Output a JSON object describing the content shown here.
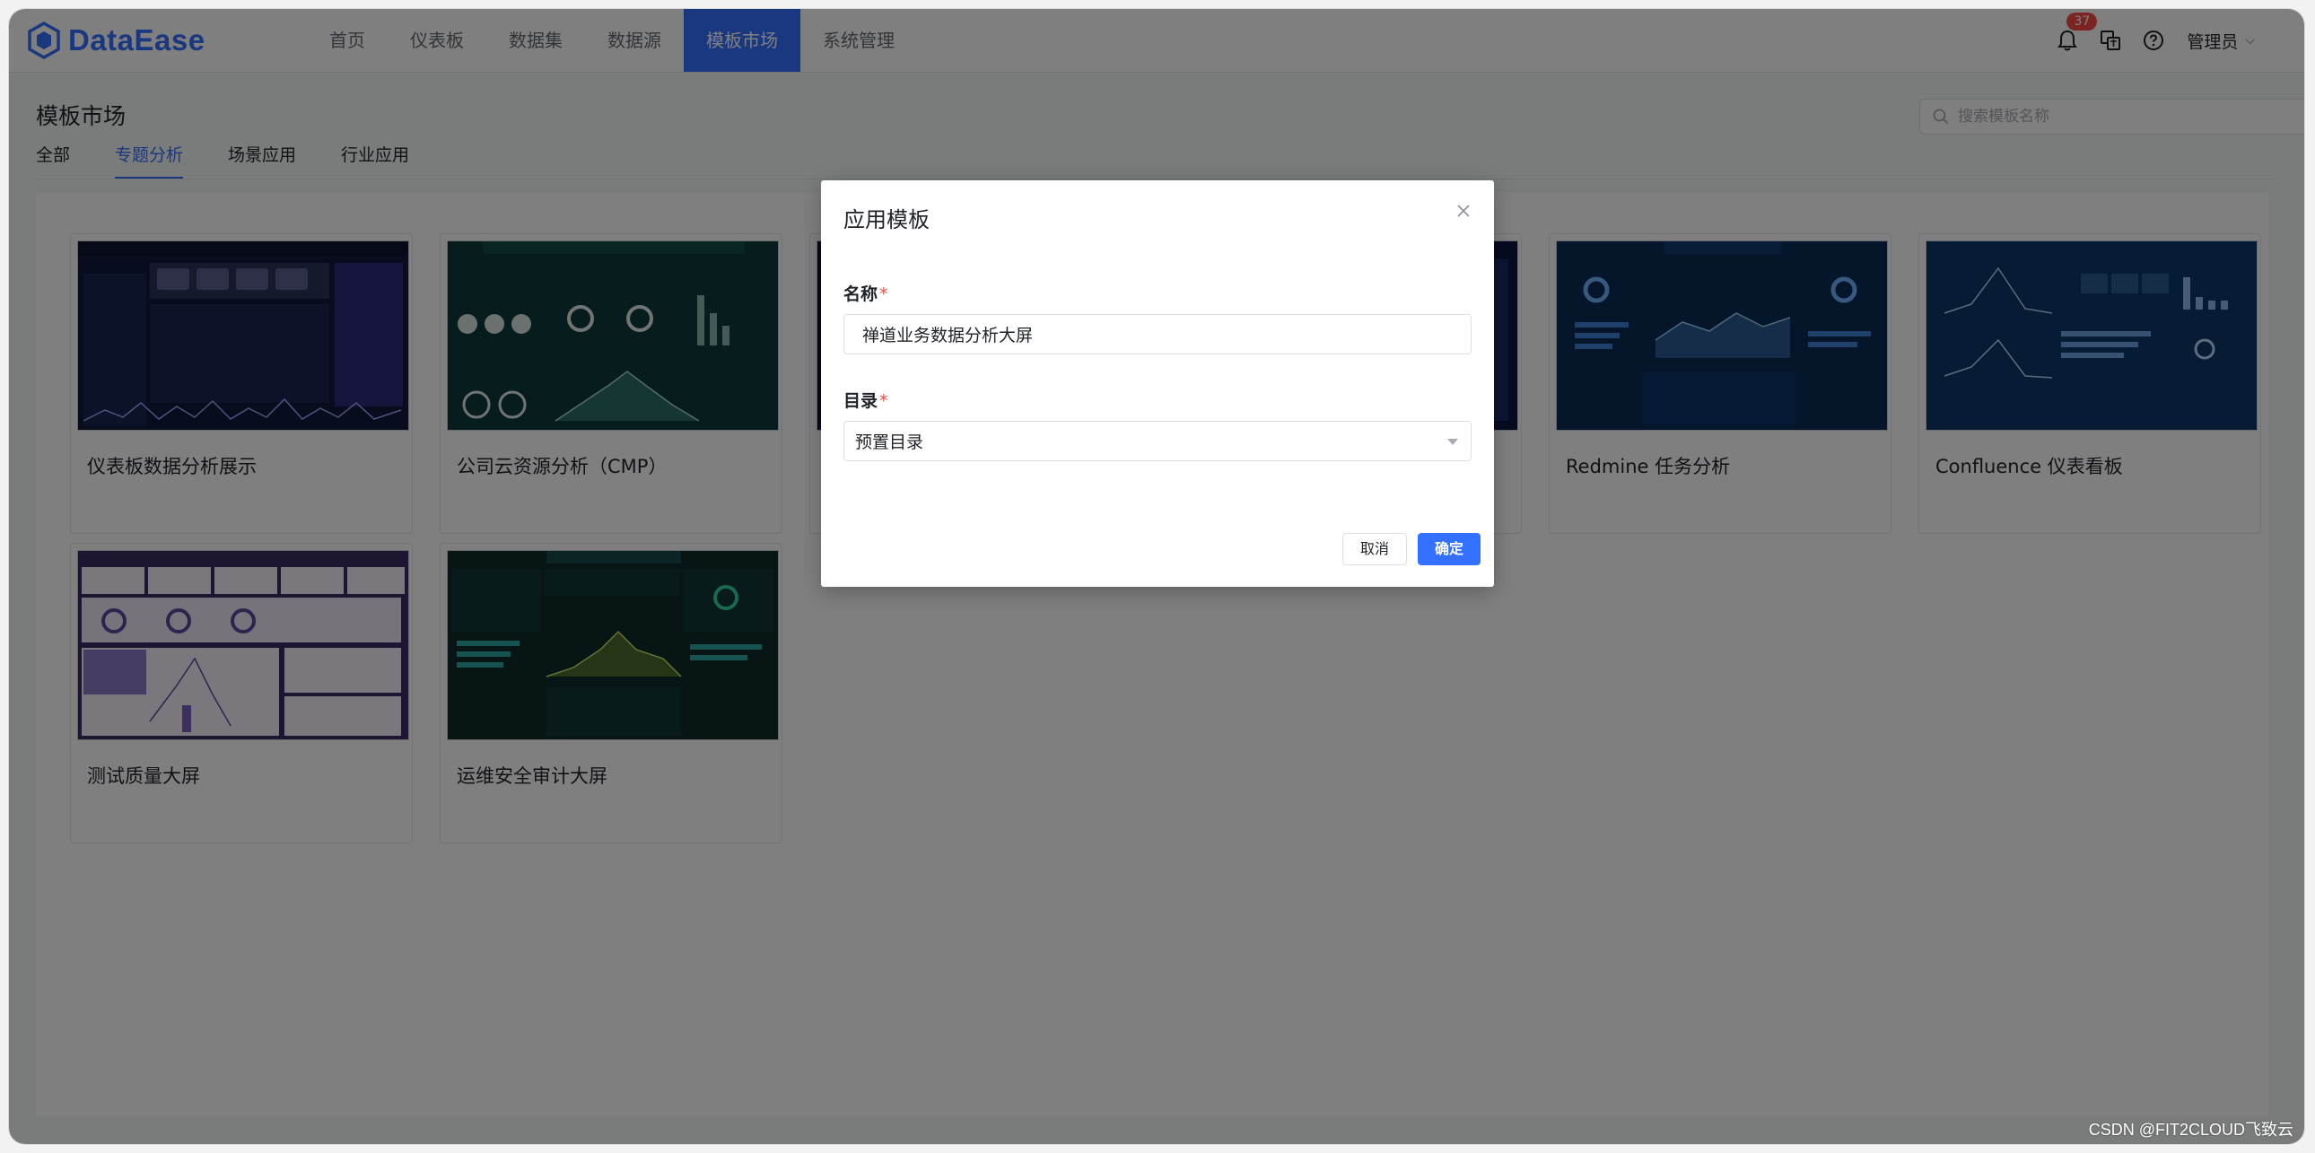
{
  "app": {
    "logo_text": "DataEase"
  },
  "nav": {
    "items": [
      {
        "label": "首页"
      },
      {
        "label": "仪表板"
      },
      {
        "label": "数据集"
      },
      {
        "label": "数据源"
      },
      {
        "label": "模板市场",
        "active": true
      },
      {
        "label": "系统管理"
      }
    ]
  },
  "header": {
    "notification_count": "37",
    "user_name": "管理员"
  },
  "page": {
    "title": "模板市场",
    "search_placeholder": "搜索模板名称",
    "tabs": [
      {
        "label": "全部"
      },
      {
        "label": "专题分析",
        "active": true
      },
      {
        "label": "场景应用"
      },
      {
        "label": "行业应用"
      }
    ]
  },
  "cards": [
    {
      "title": "仪表板数据分析展示"
    },
    {
      "title": "公司云资源分析（CMP）"
    },
    {
      "title": ""
    },
    {
      "title": ""
    },
    {
      "title": "Redmine 任务分析"
    },
    {
      "title": "Confluence 仪表看板"
    },
    {
      "title": "测试质量大屏"
    },
    {
      "title": "运维安全审计大屏"
    }
  ],
  "dialog": {
    "title": "应用模板",
    "name_label": "名称",
    "name_value": "禅道业务数据分析大屏",
    "dir_label": "目录",
    "dir_value": "预置目录",
    "required_mark": "*",
    "cancel_label": "取消",
    "ok_label": "确定"
  },
  "theme": {
    "accent": "#3370ff",
    "danger": "#f54a45"
  },
  "watermark": "CSDN @FIT2CLOUD飞致云"
}
